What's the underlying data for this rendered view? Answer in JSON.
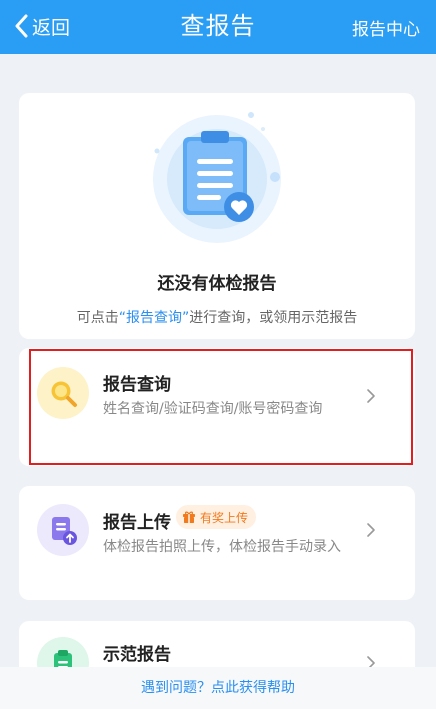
{
  "navbar": {
    "back_label": "返回",
    "title": "查报告",
    "right_link": "报告中心",
    "bg_color": "#2a9df4"
  },
  "empty_state": {
    "title": "还没有体检报告",
    "desc_prefix": "可点击",
    "desc_link": "“报告查询”",
    "desc_suffix": "进行查询，或领用示范报告",
    "illustration": "clipboard-heart-icon"
  },
  "menu": [
    {
      "title": "报告查询",
      "subtitle": "姓名查询/验证码查询/账号密码查询",
      "icon": "magnifier-icon",
      "highlighted": true
    },
    {
      "title": "报告上传",
      "badge": "有奖上传",
      "badge_icon": "gift-icon",
      "subtitle": "体检报告拍照上传，体检报告手动录入",
      "icon": "document-upload-icon"
    },
    {
      "title": "示范报告",
      "icon": "clipboard-icon"
    }
  ],
  "footer": {
    "help_link": "遇到问题？点此获得帮助"
  },
  "colors": {
    "accent": "#2a9df4",
    "link": "#2a8ff0",
    "highlight_border": "#e02020",
    "badge": "#f07a1d"
  }
}
